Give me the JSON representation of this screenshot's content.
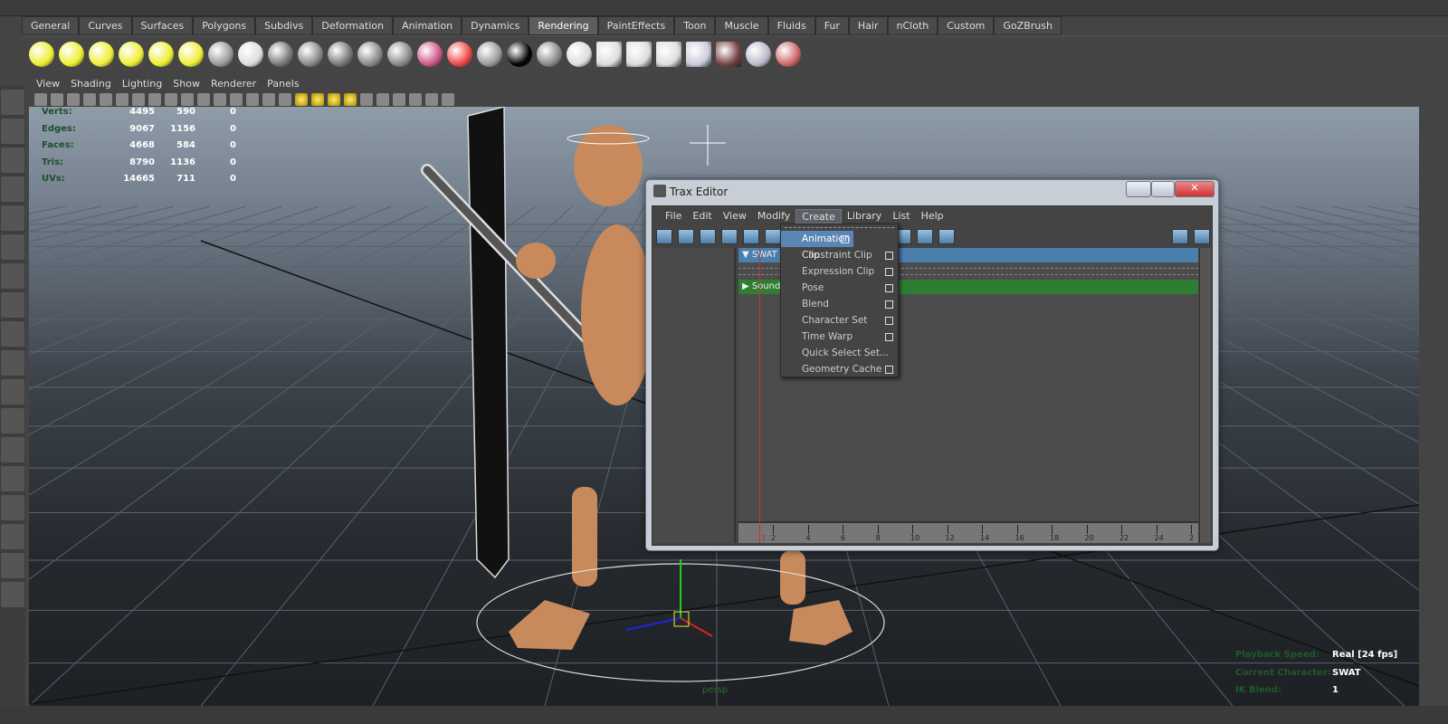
{
  "shelf": {
    "tabs": [
      "General",
      "Curves",
      "Surfaces",
      "Polygons",
      "Subdivs",
      "Deformation",
      "Animation",
      "Dynamics",
      "Rendering",
      "PaintEffects",
      "Toon",
      "Muscle",
      "Fluids",
      "Fur",
      "Hair",
      "nCloth",
      "Custom",
      "GoZBrush"
    ],
    "active": "Rendering"
  },
  "viewport": {
    "menu": [
      "View",
      "Shading",
      "Lighting",
      "Show",
      "Renderer",
      "Panels"
    ],
    "camera": "persp"
  },
  "hud": {
    "rows": [
      {
        "label": "Verts:",
        "v": [
          "4495",
          "590",
          "0"
        ]
      },
      {
        "label": "Edges:",
        "v": [
          "9067",
          "1156",
          "0"
        ]
      },
      {
        "label": "Faces:",
        "v": [
          "4668",
          "584",
          "0"
        ]
      },
      {
        "label": "Tris:",
        "v": [
          "8790",
          "1136",
          "0"
        ]
      },
      {
        "label": "UVs:",
        "v": [
          "14665",
          "711",
          "0"
        ]
      }
    ],
    "right": [
      {
        "label": "Playback Speed:",
        "value": "Real [24 fps]"
      },
      {
        "label": "Current Character:",
        "value": "SWAT"
      },
      {
        "label": "IK Blend:",
        "value": "1"
      }
    ]
  },
  "trax": {
    "title": "Trax Editor",
    "menu": [
      "File",
      "Edit",
      "View",
      "Modify",
      "Create",
      "Library",
      "List",
      "Help"
    ],
    "open_menu": "Create",
    "tracks": {
      "character": "SWAT",
      "sound": "Soundt"
    },
    "current_frame": "1",
    "timeline_ticks": [
      "2",
      "4",
      "6",
      "8",
      "10",
      "12",
      "14",
      "16",
      "18",
      "20",
      "22",
      "24",
      "2"
    ],
    "dropdown": [
      {
        "label": "Animation Clip",
        "option": true
      },
      {
        "label": "Constraint Clip",
        "option": true
      },
      {
        "label": "Expression Clip",
        "option": true
      },
      {
        "label": "Pose",
        "option": true
      },
      {
        "label": "Blend",
        "option": true
      },
      {
        "label": "Character Set",
        "option": true
      },
      {
        "label": "Time Warp",
        "option": true
      },
      {
        "label": "Quick Select Set...",
        "option": false
      },
      {
        "label": "Geometry Cache",
        "option": true
      }
    ]
  }
}
